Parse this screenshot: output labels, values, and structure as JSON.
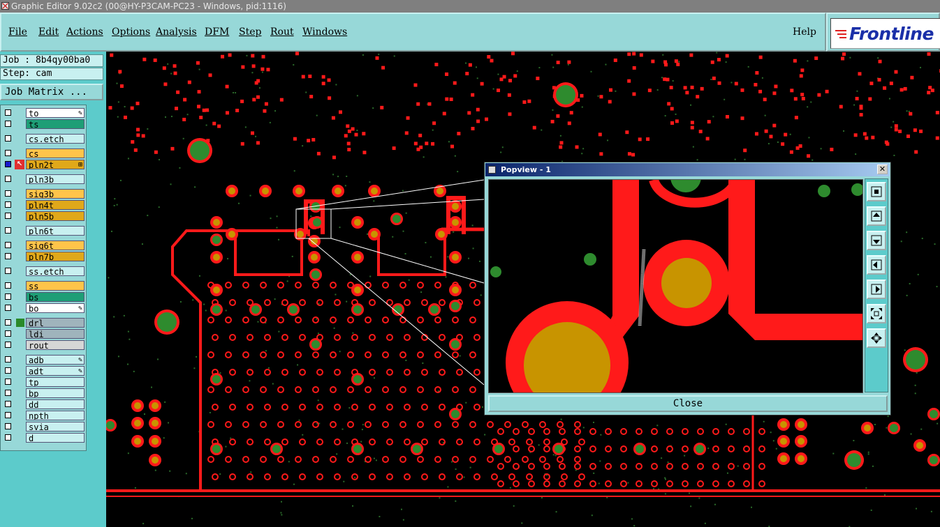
{
  "window": {
    "title": "Graphic Editor 9.02c2 (00@HY-P3CAM-PC23 - Windows, pid:1116)"
  },
  "menu": {
    "items": [
      "File",
      "Edit",
      "Actions",
      "Options",
      "Analysis",
      "DFM",
      "Step",
      "Rout",
      "Windows"
    ],
    "help": "Help"
  },
  "logo": {
    "text": "Frontline"
  },
  "job": {
    "label": "Job : 8b4qy00ba0",
    "step": "Step: cam",
    "matrix_button": "Job Matrix ..."
  },
  "layers": [
    {
      "name": "to",
      "color": "#ffffff",
      "mark": "pen",
      "checked": false
    },
    {
      "name": "ts",
      "color": "#1e9e76",
      "mark": "",
      "checked": false
    },
    {
      "name": "cs.etch",
      "color": "#c8f0f0",
      "mark": "",
      "checked": false
    },
    {
      "name": "cs",
      "color": "#ffc44a",
      "mark": "",
      "checked": false
    },
    {
      "name": "pln2t",
      "color": "#e0a81a",
      "mark": "grid",
      "checked": true,
      "active": true
    },
    {
      "name": "pln3b",
      "color": "#c8f0f0",
      "mark": "",
      "checked": false
    },
    {
      "name": "sig3b",
      "color": "#ffc44a",
      "mark": "",
      "checked": false
    },
    {
      "name": "pln4t",
      "color": "#e0a81a",
      "mark": "",
      "checked": false
    },
    {
      "name": "pln5b",
      "color": "#e0a81a",
      "mark": "",
      "checked": false
    },
    {
      "name": "pln6t",
      "color": "#c8f0f0",
      "mark": "",
      "checked": false
    },
    {
      "name": "sig6t",
      "color": "#ffc44a",
      "mark": "",
      "checked": false
    },
    {
      "name": "pln7b",
      "color": "#e0a81a",
      "mark": "",
      "checked": false
    },
    {
      "name": "ss.etch",
      "color": "#c8f0f0",
      "mark": "",
      "checked": false
    },
    {
      "name": "ss",
      "color": "#ffc44a",
      "mark": "",
      "checked": false
    },
    {
      "name": "bs",
      "color": "#1e9e76",
      "mark": "",
      "checked": false
    },
    {
      "name": "bo",
      "color": "#ffffff",
      "mark": "pen",
      "checked": false
    },
    {
      "name": "drl",
      "color": "#9fb4bc",
      "mark": "",
      "checked": true,
      "drill": true
    },
    {
      "name": "ldi",
      "color": "#9fb4bc",
      "mark": "",
      "checked": false
    },
    {
      "name": "rout",
      "color": "#d6d6d6",
      "mark": "",
      "checked": false
    },
    {
      "name": "adb",
      "color": "#c8f0f0",
      "mark": "pen",
      "checked": false
    },
    {
      "name": "adt",
      "color": "#c8f0f0",
      "mark": "pen",
      "checked": false
    },
    {
      "name": "tp",
      "color": "#c8f0f0",
      "mark": "",
      "checked": false
    },
    {
      "name": "bp",
      "color": "#c8f0f0",
      "mark": "",
      "checked": false
    },
    {
      "name": "dd",
      "color": "#c8f0f0",
      "mark": "",
      "checked": false
    },
    {
      "name": "npth",
      "color": "#c8f0f0",
      "mark": "",
      "checked": false
    },
    {
      "name": "svia",
      "color": "#c8f0f0",
      "mark": "",
      "checked": false
    },
    {
      "name": "d",
      "color": "#c8f0f0",
      "mark": "",
      "checked": false
    }
  ],
  "popview": {
    "title": "Popview - 1",
    "close_label": "Close"
  },
  "colors": {
    "copper": "#ff1a1a",
    "pad": "#c89400",
    "via": "#2e8b2e",
    "background": "#000000",
    "panel": "#97d8d8"
  }
}
